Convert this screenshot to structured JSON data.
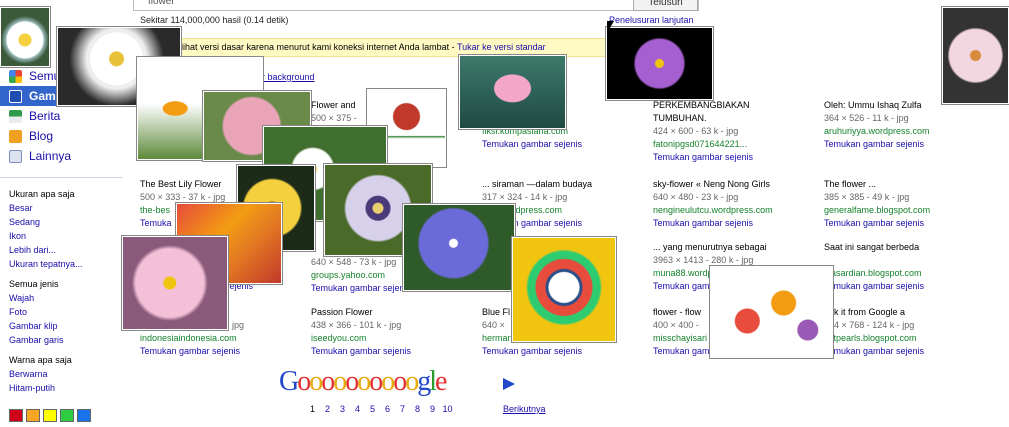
{
  "search": {
    "query": "flower",
    "button": "Telusuri"
  },
  "stats": "Sekitar 114,000,000 hasil (0.14 detik)",
  "advanced": "Penelusuran lanjutan",
  "notice": {
    "text": "elihat versi dasar karena menurut kami koneksi internet Anda lambat -",
    "link": "Tukar ke versi standar"
  },
  "bg_link": "er background",
  "nav": [
    {
      "label": "Semua",
      "icon": "google-g-icon",
      "color": "#4a8af4"
    },
    {
      "label": "Gambar",
      "icon": "camera-icon",
      "color": "#ffffff"
    },
    {
      "label": "Berita",
      "icon": "news-icon",
      "color": "#2d9b4a"
    },
    {
      "label": "Blog",
      "icon": "blog-icon",
      "color": "#f0a020"
    },
    {
      "label": "Lainnya",
      "icon": "keyboard-icon",
      "color": "#7a8fbf"
    }
  ],
  "filters": {
    "size_header": "Ukuran apa saja",
    "sizes": [
      "Besar",
      "Sedang",
      "Ikon",
      "Lebih dari...",
      "Ukuran tepatnya..."
    ],
    "type_header": "Semua jenis",
    "types": [
      "Wajah",
      "Foto",
      "Gambar klip",
      "Gambar garis"
    ],
    "color_header": "Warna apa saja",
    "colors": [
      "Berwarna",
      "Hitam-putih"
    ],
    "swatches": [
      "#d0021b",
      "#f5a623",
      "#ffff00",
      "#2ecc40",
      "#1a73e8"
    ]
  },
  "results": [
    {
      "t": "Flower and",
      "m": "500 × 375 -",
      "u": "",
      "s": ""
    },
    {
      "t": "n. Adot jejaka",
      "m": "- jpg",
      "u": "fiksi.kompasiana.com",
      "s": "Temukan gambar sejenis"
    },
    {
      "t": "PERKEMBANGBIAKAN",
      "m": "TUMBUHAN.",
      "u": "",
      "s": ""
    },
    {
      "t": "424 × 600 - 63 k - jpg",
      "m": "fatonipgsd071644221...",
      "u": "Temukan gambar sejenis",
      "s": ""
    },
    {
      "t": "Oleh: Ummu Ishaq Zulfa",
      "m": "364 × 526 - 11 k - jpg",
      "u": "aruhuriyya.wordpress.com",
      "s": "Temukan gambar sejenis"
    },
    {
      "t": "The Best Lily Flower",
      "m": "500 × 333 - 37 k - jpg",
      "u": "the-bes",
      "s": "Temuka"
    },
    {
      "t": "... siraman —dalam budaya",
      "m": "317 × 324 - 14 k - jpg",
      "u": "...ss.wordpress.com",
      "s": "Temukan gambar sejenis"
    },
    {
      "t": "sky-flower « Neng Nong Girls",
      "m": "640 × 480 - 23 k - jpg",
      "u": "nengineulutcu.wordpress.com",
      "s": "Temukan gambar sejenis"
    },
    {
      "t": "The flower ...",
      "m": "385 × 385 - 49 k - jpg",
      "u": "generalfame.blogspot.com",
      "s": "Temukan gambar sejenis"
    },
    {
      "t": "... yang menurutnya sebagai",
      "m": "3963 × 1413 - 280 k - jpg",
      "u": "muna88.wordpress.com",
      "s": "Temukan gambar sejenis"
    },
    {
      "t": "Saat ini sangat berbeda",
      "m": "",
      "u": "alasardian.blogspot.com",
      "s": "Temukan gambar sejenis"
    },
    {
      "t": "groups.yahoo.com",
      "m": "Temukan gambar sejenis",
      "u": "",
      "s": ""
    },
    {
      "t": "Passion Flower",
      "m": "438 × 366 - 101 k - jpg",
      "u": "iseedyou.com",
      "s": "Temukan gambar sejenis"
    },
    {
      "t": "Blue Fl",
      "m": "640 ×",
      "u": "hermann-dite.de",
      "s": "Temukan gambar sejenis"
    },
    {
      "t": "flower - flow",
      "m": "400 × 400 -",
      "u": "misschayisari",
      "s": "Temukan gambar sejenis"
    },
    {
      "t": "ook it from Google a",
      "m": "224 × 768 - 124 k - jpg",
      "u": "estpearls.blogspot.com",
      "s": "Temukan gambar sejenis"
    },
    {
      "t": "jpg",
      "m": "indonesiaindonesia.com",
      "u": "Temukan gambar sejenis",
      "s": ""
    },
    {
      "t": "640 × 548 - 73 k - jpg",
      "m": "",
      "u": "",
      "s": ""
    },
    {
      "t": "sejenis",
      "m": "",
      "u": "",
      "s": ""
    }
  ],
  "pager": {
    "logo": "Goooooooooogle",
    "pages": [
      "1",
      "2",
      "3",
      "4",
      "5",
      "6",
      "7",
      "8",
      "9",
      "10"
    ],
    "next": "Berikutnya"
  }
}
